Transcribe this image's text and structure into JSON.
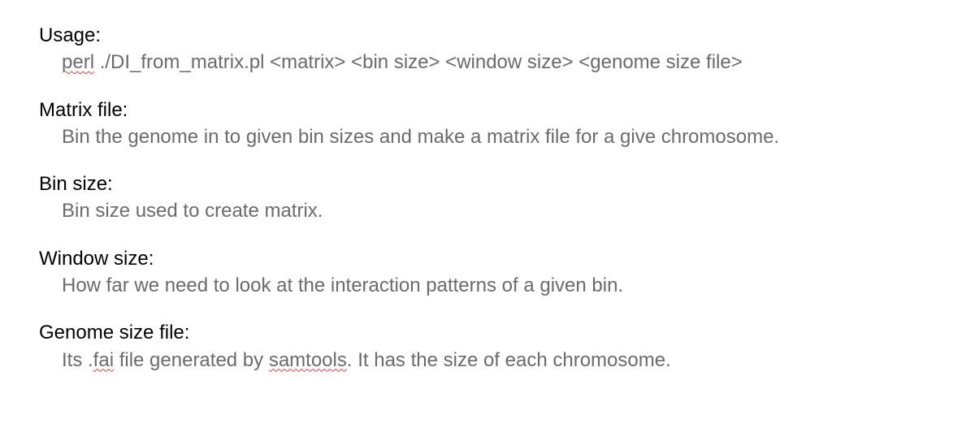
{
  "sections": {
    "usage": {
      "heading": "Usage:",
      "word_perl": "perl",
      "rest": " ./DI_from_matrix.pl <matrix> <bin size> <window size> <genome size file>"
    },
    "matrix": {
      "heading": "Matrix file:",
      "body": "Bin the genome in to given bin sizes and make a matrix file for a give chromosome."
    },
    "binsize": {
      "heading": "Bin size:",
      "body": "Bin size used to create matrix."
    },
    "windowsize": {
      "heading": "Window size:",
      "body": "How far we need to look at the interaction patterns of a given bin."
    },
    "genomesize": {
      "heading": "Genome size file:",
      "prefix": "Its .",
      "word_fai": "fai",
      "mid": " file generated by ",
      "word_samtools": "samtools",
      "suffix": ". It has the size of each chromosome."
    }
  }
}
